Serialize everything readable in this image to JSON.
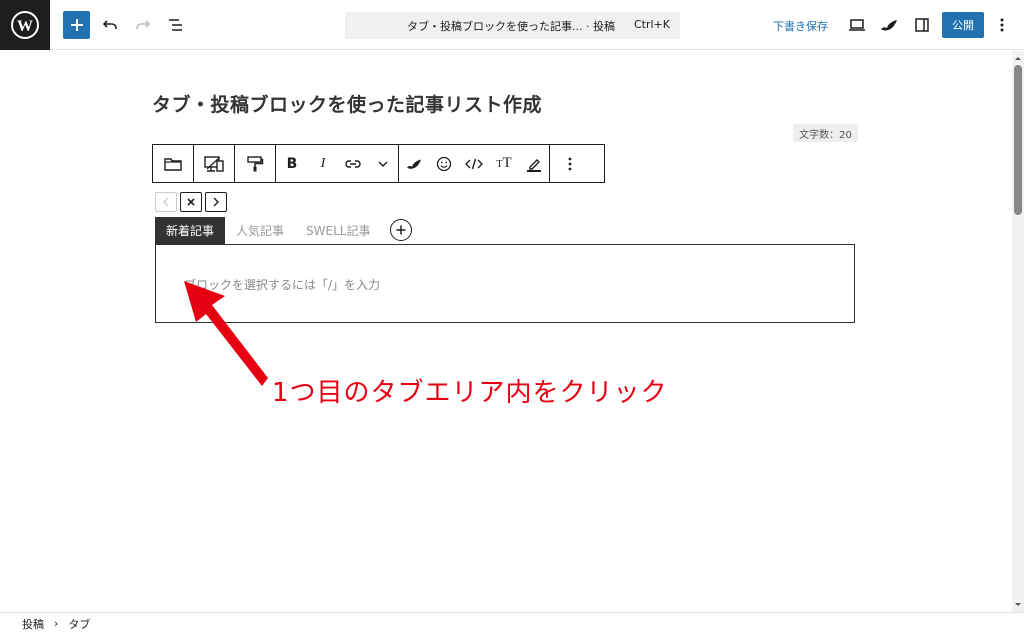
{
  "topbar": {
    "command_title": "タブ・投稿ブロックを使った記事... · 投稿",
    "command_shortcut": "Ctrl+K",
    "save_draft": "下書き保存",
    "publish": "公開"
  },
  "editor": {
    "post_title": "タブ・投稿ブロックを使った記事リスト作成",
    "char_count": "文字数：20",
    "tabs": [
      {
        "label": "新着記事",
        "active": true
      },
      {
        "label": "人気記事",
        "active": false
      },
      {
        "label": "SWELL記事",
        "active": false
      }
    ],
    "placeholder": "ブロックを選択するには「/」を入力"
  },
  "annotation": {
    "text": "1つ目のタブエリア内をクリック",
    "color": "#e60012"
  },
  "breadcrumb": {
    "items": [
      "投稿",
      "タブ"
    ],
    "separator": "›"
  },
  "colors": {
    "accent": "#2271b1",
    "logo_bg": "#1e1e1e"
  }
}
